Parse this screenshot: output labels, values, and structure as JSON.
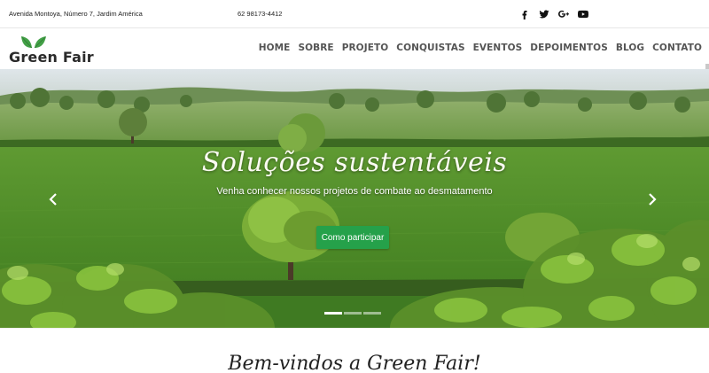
{
  "topbar": {
    "address": "Avenida Montoya, Número 7, Jardim América",
    "phone": "62 98173-4412",
    "social": [
      {
        "icon": "facebook-icon"
      },
      {
        "icon": "twitter-icon"
      },
      {
        "icon": "google-plus-icon"
      },
      {
        "icon": "youtube-icon"
      }
    ]
  },
  "navbar": {
    "brand": "Green Fair",
    "menu": [
      "HOME",
      "SOBRE",
      "PROJETO",
      "CONQUISTAS",
      "EVENTOS",
      "DEPOIMENTOS",
      "BLOG",
      "CONTATO"
    ]
  },
  "hero": {
    "title": "Soluções sustentáveis",
    "subtitle": "Venha conhecer nossos projetos de combate ao desmatamento",
    "cta": "Como participar",
    "slides": 3,
    "active_slide": 1
  },
  "welcome": {
    "heading": "Bem-vindos a Green Fair!"
  },
  "colors": {
    "accent_green": "#25a14a",
    "leaf_green": "#4caf50",
    "nav_text": "#555555"
  }
}
